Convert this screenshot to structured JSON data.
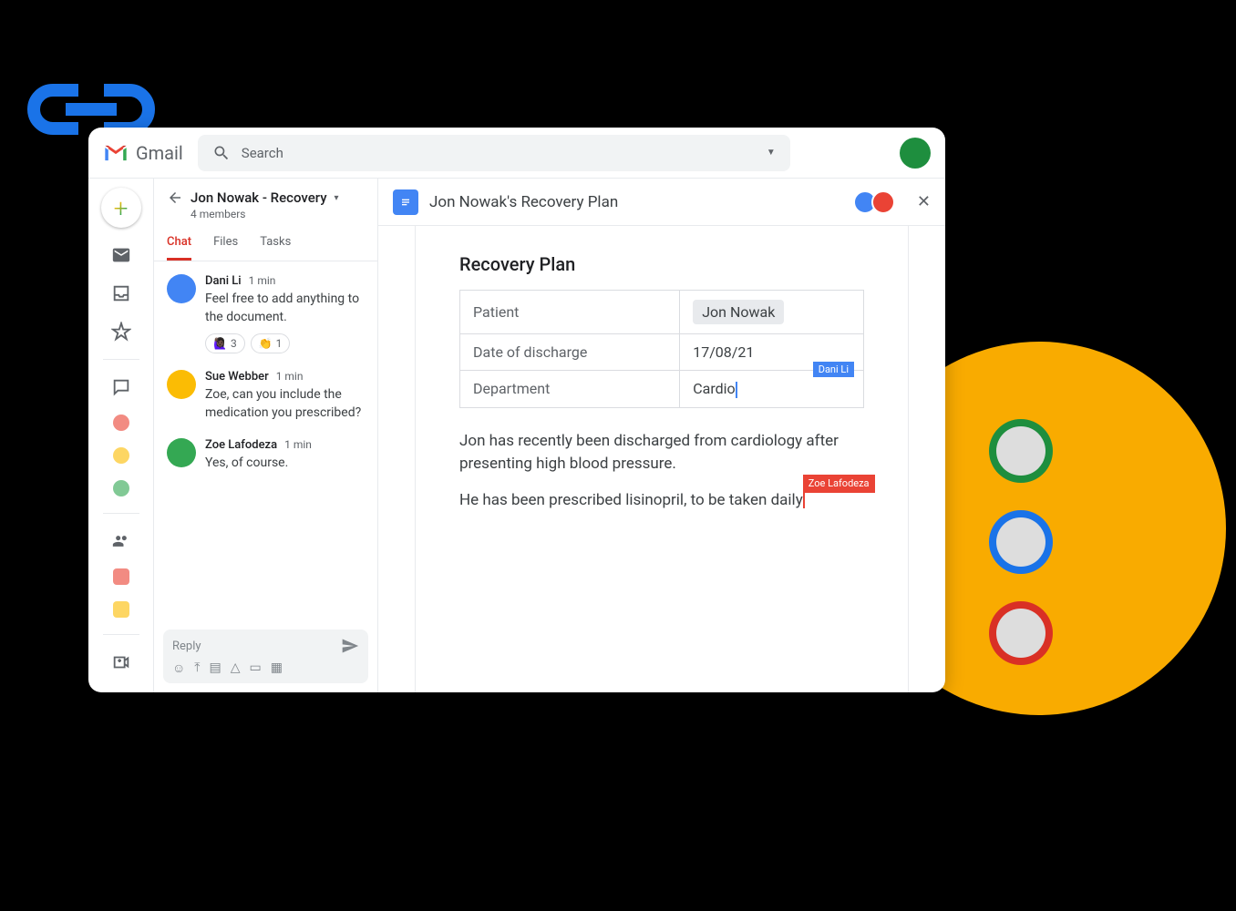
{
  "brand": "Gmail",
  "search": {
    "placeholder": "Search"
  },
  "chat": {
    "room_title": "Jon Nowak - Recovery",
    "members": "4 members",
    "tabs": [
      "Chat",
      "Files",
      "Tasks"
    ],
    "active_tab": 0,
    "messages": [
      {
        "author": "Dani Li",
        "time": "1 min",
        "text": "Feel free to add anything to the document.",
        "reactions": [
          {
            "emoji": "🙋🏿‍♀️",
            "count": "3"
          },
          {
            "emoji": "👏",
            "count": "1"
          }
        ]
      },
      {
        "author": "Sue Webber",
        "time": "1 min",
        "text": "Zoe, can you include the medication you prescribed?"
      },
      {
        "author": "Zoe Lafodeza",
        "time": "1 min",
        "text": "Yes, of course."
      }
    ],
    "reply_placeholder": "Reply"
  },
  "document": {
    "title": "Jon Nowak's Recovery Plan",
    "heading": "Recovery Plan",
    "table": [
      {
        "label": "Patient",
        "value": "Jon Nowak",
        "highlighted": true
      },
      {
        "label": "Date of discharge",
        "value": "17/08/21"
      },
      {
        "label": "Department",
        "value": "Cardio",
        "cursor": {
          "user": "Dani Li",
          "color": "blue"
        }
      }
    ],
    "paragraphs": [
      "Jon has recently been discharged from cardiology after presenting high blood pressure."
    ],
    "editing_paragraph": {
      "before": "He has been prescribed lisinopril, to be taken daily",
      "cursor": {
        "user": "Zoe Lafodeza",
        "color": "red"
      }
    }
  }
}
